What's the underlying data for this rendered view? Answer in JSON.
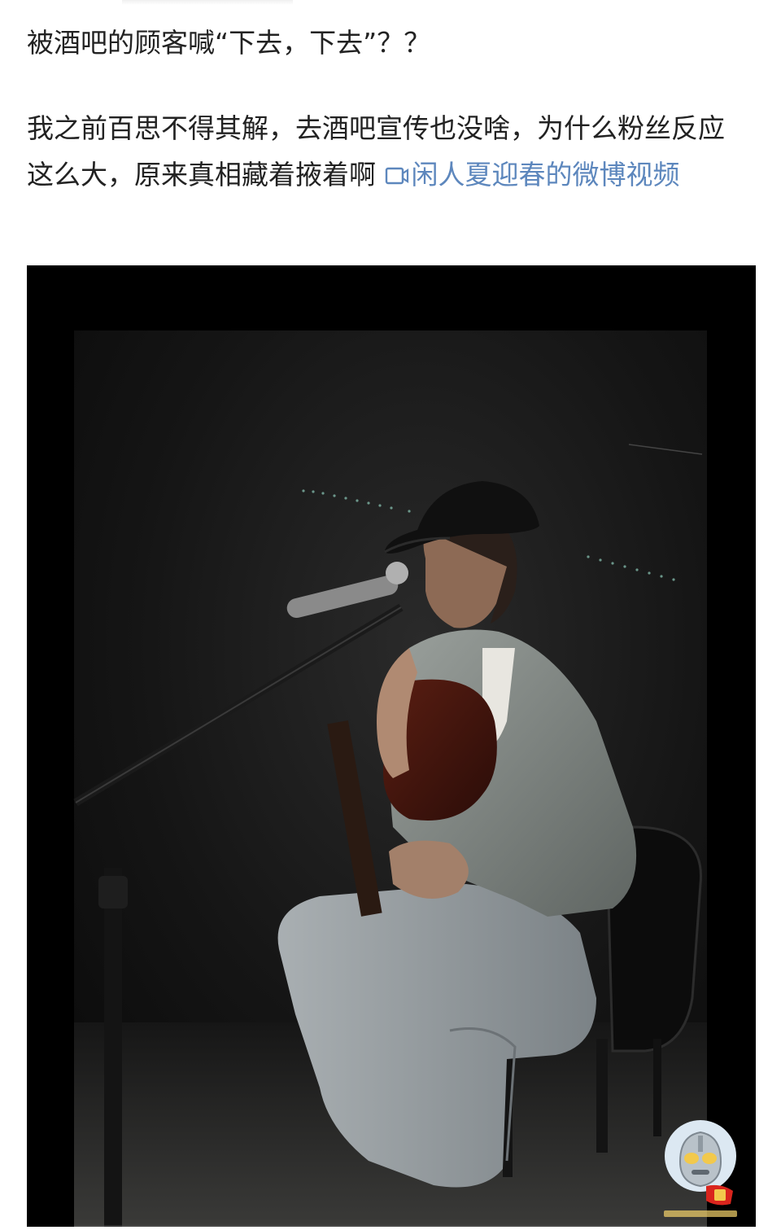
{
  "post": {
    "title": "被酒吧的顾客喊“下去，下去”？？",
    "body_text": "我之前百思不得其解，去酒吧宣传也没啥，为什么粉丝反应这么大，原来真相藏着掖着啊",
    "video_link": "闲人夏迎春的微博视频"
  },
  "media": {
    "alt_icon": "photo-of-musician",
    "sticker_icon": "ultraman-sticker-icon"
  },
  "colors": {
    "link": "#5d87bd",
    "text": "#222222",
    "frame": "#000000",
    "stage": "#121212"
  }
}
